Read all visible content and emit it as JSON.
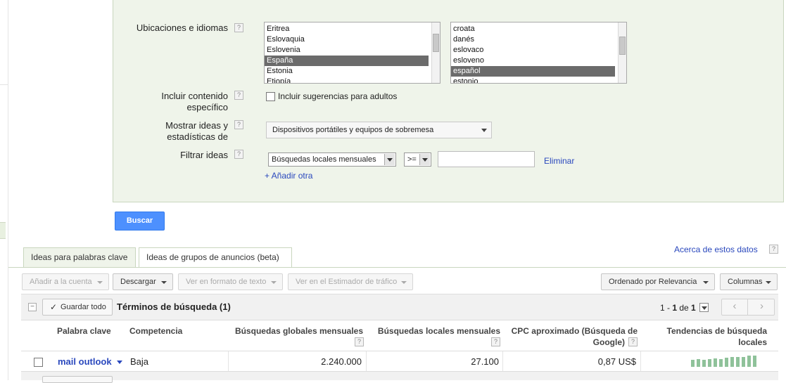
{
  "form": {
    "locations_label": "Ubicaciones e idiomas",
    "help_glyph": "?",
    "locations": [
      {
        "text": "Eritrea",
        "selected": false
      },
      {
        "text": "Eslovaquia",
        "selected": false
      },
      {
        "text": "Eslovenia",
        "selected": false
      },
      {
        "text": "España",
        "selected": true
      },
      {
        "text": "Estonia",
        "selected": false
      },
      {
        "text": "Etiopía",
        "selected": false
      }
    ],
    "languages": [
      {
        "text": "croata",
        "selected": false
      },
      {
        "text": "danés",
        "selected": false
      },
      {
        "text": "eslovaco",
        "selected": false
      },
      {
        "text": "esloveno",
        "selected": false
      },
      {
        "text": "español",
        "selected": true
      },
      {
        "text": "estonio",
        "selected": false
      }
    ],
    "include_label_1": "Incluir contenido",
    "include_label_2": "específico",
    "adult_checkbox_label": "Incluir sugerencias para adultos",
    "show_label_1": "Mostrar ideas y",
    "show_label_2": "estadísticas de",
    "device_value": "Dispositivos portátiles y equipos de sobremesa",
    "filter_label": "Filtrar ideas",
    "filter_metric": "Búsquedas locales mensuales",
    "filter_operator": ">=",
    "filter_value": "",
    "remove_link": "Eliminar",
    "add_link": "+ Añadir otra"
  },
  "search_button": "Buscar",
  "tabs": [
    {
      "label": "Ideas para palabras clave",
      "active": false
    },
    {
      "label": "Ideas de grupos de anuncios (beta)",
      "active": true
    }
  ],
  "about_link": "Acerca de estos datos",
  "toolbar": {
    "add_to_account": "Añadir a la cuenta",
    "download": "Descargar",
    "text_format": "Ver en formato de texto",
    "traffic_estimator": "Ver en el Estimador de tráfico",
    "sort": "Ordenado por Relevancia",
    "columns": "Columnas"
  },
  "group": {
    "collapse_glyph": "−",
    "save_all": "Guardar todo",
    "title": "Términos de búsqueda (1)",
    "page_prefix": "1 - ",
    "page_current": "1",
    "page_mid": " de ",
    "page_total": "1",
    "prev_glyph": "‹",
    "next_glyph": "›"
  },
  "table": {
    "headers": {
      "keyword": "Palabra clave",
      "competition": "Competencia",
      "global": "Búsquedas globales mensuales",
      "local": "Búsquedas locales mensuales",
      "cpc_1": "CPC aproximado (Búsqueda de",
      "cpc_2": "Google)",
      "trends_1": "Tendencias de búsqueda",
      "trends_2": "locales"
    },
    "rows": [
      {
        "keyword": "mail outlook",
        "competition": "Baja",
        "global": "2.240.000",
        "local": "27.100",
        "cpc": "0,87 US$",
        "trend": [
          0.55,
          0.6,
          0.55,
          0.6,
          0.65,
          0.6,
          0.7,
          0.75,
          0.8,
          0.8,
          0.9,
          0.9
        ]
      }
    ]
  },
  "colors": {
    "accent": "#4d90fe",
    "link": "#2a48bd",
    "panel": "#eff4ea",
    "trend_bar": "#8fc29a"
  }
}
